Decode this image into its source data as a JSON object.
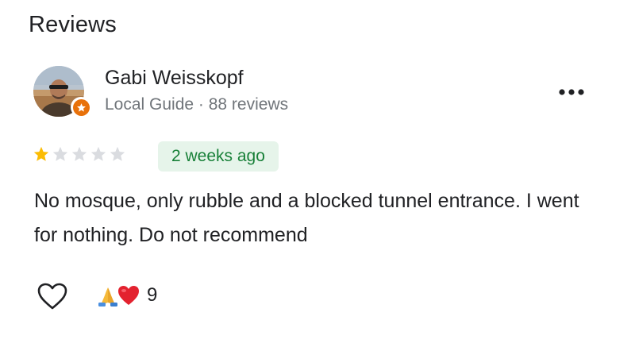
{
  "section": {
    "title": "Reviews"
  },
  "review": {
    "author_name": "Gabi Weisskopf",
    "author_meta": "Local Guide · 88 reviews",
    "rating": 1,
    "rating_max": 5,
    "time_ago": "2 weeks ago",
    "text": "No mosque, only rubble and a blocked tunnel entrance. I went for nothing. Do not recommend",
    "reactions": {
      "emojis": [
        "folded-hands-icon",
        "red-heart-icon"
      ],
      "count": "9"
    }
  },
  "colors": {
    "star_filled": "#fbbc04",
    "star_empty": "#dadce0",
    "badge_bg": "#e6f4ea",
    "badge_text": "#188038",
    "local_guide_badge": "#e8710a"
  }
}
